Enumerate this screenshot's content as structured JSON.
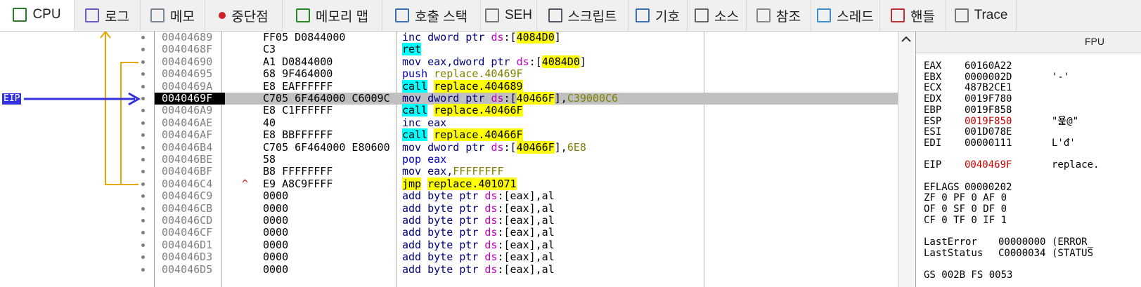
{
  "tabs": [
    {
      "label": "CPU",
      "icon": "cpu-icon",
      "active": true
    },
    {
      "label": "로그",
      "icon": "log-icon"
    },
    {
      "label": "메모",
      "icon": "notes-icon"
    },
    {
      "label": "중단점",
      "icon": "breakpoint-icon"
    },
    {
      "label": "메모리 맵",
      "icon": "memory-map-icon"
    },
    {
      "label": "호출 스택",
      "icon": "call-stack-icon"
    },
    {
      "label": "SEH",
      "icon": "seh-icon"
    },
    {
      "label": "스크립트",
      "icon": "script-icon"
    },
    {
      "label": "기호",
      "icon": "symbols-icon"
    },
    {
      "label": "소스",
      "icon": "source-icon"
    },
    {
      "label": "참조",
      "icon": "references-icon"
    },
    {
      "label": "스레드",
      "icon": "threads-icon"
    },
    {
      "label": "핸들",
      "icon": "handles-icon"
    },
    {
      "label": "Trace",
      "icon": "trace-icon"
    }
  ],
  "eip_label": "EIP",
  "disasm": [
    {
      "addr": "00404689",
      "bytes": "FF05 D0844000",
      "asm": [
        {
          "t": "inc dword ptr ",
          "c": "kw"
        },
        {
          "t": "ds",
          "c": "mag"
        },
        {
          "t": ":["
        },
        {
          "t": "4084D0",
          "c": "hl-y"
        },
        {
          "t": "]"
        }
      ]
    },
    {
      "addr": "0040468F",
      "bytes": "C3",
      "asm": [
        {
          "t": "ret",
          "c": "hl-c"
        }
      ]
    },
    {
      "addr": "00404690",
      "bytes": "A1 D0844000",
      "asm": [
        {
          "t": "mov eax,dword ptr ",
          "c": "kw"
        },
        {
          "t": "ds",
          "c": "mag"
        },
        {
          "t": ":["
        },
        {
          "t": "4084D0",
          "c": "hl-y"
        },
        {
          "t": "]"
        }
      ]
    },
    {
      "addr": "00404695",
      "bytes": "68 9F464000",
      "asm": [
        {
          "t": "push ",
          "c": "blue"
        },
        {
          "t": "replace.40469F",
          "c": "olive"
        }
      ]
    },
    {
      "addr": "0040469A",
      "bytes": "E8 EAFFFFFF",
      "asm": [
        {
          "t": "call",
          "c": "hl-c"
        },
        {
          "t": " "
        },
        {
          "t": "replace.404689",
          "c": "hl-y"
        }
      ]
    },
    {
      "addr": "0040469F",
      "bytes": "C705 6F464000 C6009C",
      "current": true,
      "asm": [
        {
          "t": "mov dword ptr ",
          "c": "kw"
        },
        {
          "t": "ds",
          "c": "mag"
        },
        {
          "t": ":["
        },
        {
          "t": "40466F",
          "c": "hl-y"
        },
        {
          "t": "],"
        },
        {
          "t": "C39000C6",
          "c": "olive"
        }
      ]
    },
    {
      "addr": "004046A9",
      "bytes": "E8 C1FFFFFF",
      "asm": [
        {
          "t": "call",
          "c": "hl-c"
        },
        {
          "t": " "
        },
        {
          "t": "replace.40466F",
          "c": "hl-y"
        }
      ]
    },
    {
      "addr": "004046AE",
      "bytes": "40",
      "asm": [
        {
          "t": "inc eax",
          "c": "kw"
        }
      ]
    },
    {
      "addr": "004046AF",
      "bytes": "E8 BBFFFFFF",
      "asm": [
        {
          "t": "call",
          "c": "hl-c"
        },
        {
          "t": " "
        },
        {
          "t": "replace.40466F",
          "c": "hl-y"
        }
      ]
    },
    {
      "addr": "004046B4",
      "bytes": "C705 6F464000 E80600",
      "asm": [
        {
          "t": "mov dword ptr ",
          "c": "kw"
        },
        {
          "t": "ds",
          "c": "mag"
        },
        {
          "t": ":["
        },
        {
          "t": "40466F",
          "c": "hl-y"
        },
        {
          "t": "],"
        },
        {
          "t": "6E8",
          "c": "olive"
        }
      ]
    },
    {
      "addr": "004046BE",
      "bytes": "58",
      "asm": [
        {
          "t": "pop eax",
          "c": "blue"
        }
      ]
    },
    {
      "addr": "004046BF",
      "bytes": "B8 FFFFFFFF",
      "asm": [
        {
          "t": "mov eax,",
          "c": "kw"
        },
        {
          "t": "FFFFFFFF",
          "c": "olive"
        }
      ]
    },
    {
      "addr": "004046C4",
      "bytes": "E9 A8C9FFFF",
      "marker": "^",
      "asm": [
        {
          "t": "jmp",
          "c": "hl-y"
        },
        {
          "t": " "
        },
        {
          "t": "replace.401071",
          "c": "hl-y"
        }
      ]
    },
    {
      "addr": "004046C9",
      "bytes": "0000",
      "asm": [
        {
          "t": "add byte ptr ",
          "c": "kw"
        },
        {
          "t": "ds",
          "c": "mag"
        },
        {
          "t": ":[eax],al"
        }
      ]
    },
    {
      "addr": "004046CB",
      "bytes": "0000",
      "asm": [
        {
          "t": "add byte ptr ",
          "c": "kw"
        },
        {
          "t": "ds",
          "c": "mag"
        },
        {
          "t": ":[eax],al"
        }
      ]
    },
    {
      "addr": "004046CD",
      "bytes": "0000",
      "asm": [
        {
          "t": "add byte ptr ",
          "c": "kw"
        },
        {
          "t": "ds",
          "c": "mag"
        },
        {
          "t": ":[eax],al"
        }
      ]
    },
    {
      "addr": "004046CF",
      "bytes": "0000",
      "asm": [
        {
          "t": "add byte ptr ",
          "c": "kw"
        },
        {
          "t": "ds",
          "c": "mag"
        },
        {
          "t": ":[eax],al"
        }
      ]
    },
    {
      "addr": "004046D1",
      "bytes": "0000",
      "asm": [
        {
          "t": "add byte ptr ",
          "c": "kw"
        },
        {
          "t": "ds",
          "c": "mag"
        },
        {
          "t": ":[eax],al"
        }
      ]
    },
    {
      "addr": "004046D3",
      "bytes": "0000",
      "asm": [
        {
          "t": "add byte ptr ",
          "c": "kw"
        },
        {
          "t": "ds",
          "c": "mag"
        },
        {
          "t": ":[eax],al"
        }
      ]
    },
    {
      "addr": "004046D5",
      "bytes": "0000",
      "asm": [
        {
          "t": "add byte ptr ",
          "c": "kw"
        },
        {
          "t": "ds",
          "c": "mag"
        },
        {
          "t": ":[eax],al"
        }
      ]
    }
  ],
  "fpu_header": "FPU",
  "registers": [
    {
      "name": "EAX",
      "value": "60160A22",
      "comment": ""
    },
    {
      "name": "EBX",
      "value": "0000002D",
      "comment": "'-'"
    },
    {
      "name": "ECX",
      "value": "487B2CE1",
      "comment": ""
    },
    {
      "name": "EDX",
      "value": "0019F780",
      "comment": ""
    },
    {
      "name": "EBP",
      "value": "0019F858",
      "comment": ""
    },
    {
      "name": "ESP",
      "value": "0019F850",
      "comment": "\"욡@\"",
      "changed": true
    },
    {
      "name": "ESI",
      "value": "001D078E",
      "comment": ""
    },
    {
      "name": "EDI",
      "value": "00000111",
      "comment": "L'đ'"
    },
    {
      "blank": true
    },
    {
      "name": "EIP",
      "value": "0040469F",
      "comment": "replace.",
      "changed": true
    },
    {
      "blank": true
    },
    {
      "name": "EFLAGS",
      "value": "00000202",
      "comment": ""
    },
    {
      "text": "ZF 0  PF 0  AF 0"
    },
    {
      "text": "OF 0  SF 0  DF 0"
    },
    {
      "text": "CF 0  TF 0  IF 1"
    },
    {
      "blank": true
    },
    {
      "name": "LastError",
      "value": "00000000",
      "comment": "(ERROR_"
    },
    {
      "name": "LastStatus",
      "value": "C0000034",
      "comment": "(STATUS"
    },
    {
      "blank": true
    },
    {
      "text": "GS 002B  FS 0053"
    }
  ]
}
